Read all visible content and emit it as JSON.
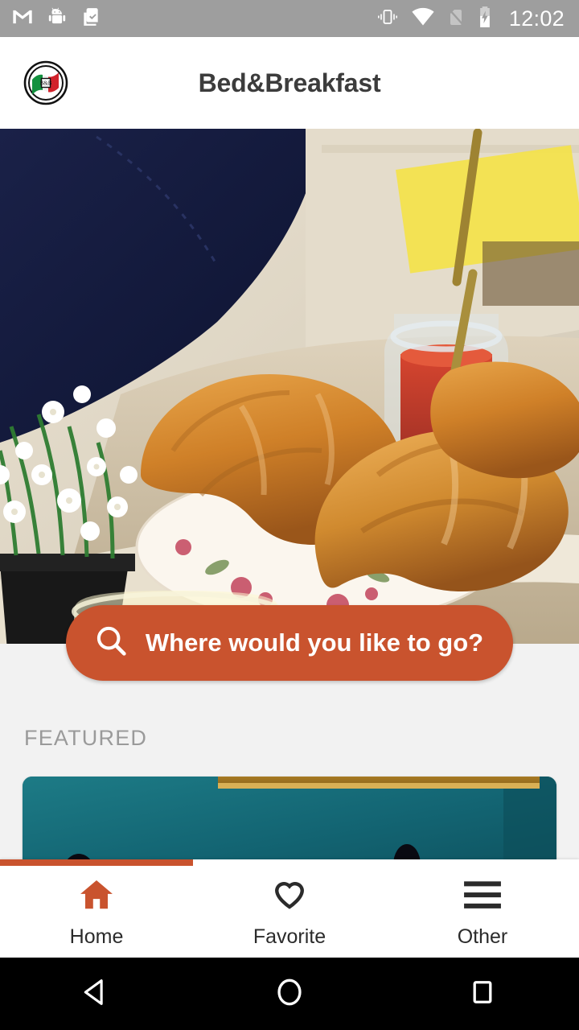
{
  "status_bar": {
    "time": "12:02",
    "left_icons": [
      "gmail-icon",
      "android-robot-icon",
      "clipboard-check-icon"
    ],
    "right_icons": [
      "vibrate-icon",
      "wifi-icon",
      "no-sim-icon",
      "battery-charging-icon"
    ],
    "background_color": "#9e9e9e"
  },
  "app_bar": {
    "title": "Bed&Breakfast",
    "logo_name": "italian-flag-roundel-logo",
    "background_color": "#ffffff",
    "title_color": "#3c3c3c"
  },
  "hero": {
    "alt": "Breakfast tray with croissants, orange juice, jam jar and white flowers",
    "name": "hero-breakfast-image"
  },
  "search": {
    "label": "Where would you like to go?",
    "line1": "Where would you like",
    "line2": "to go?",
    "icon": "search-icon",
    "accent_color": "#c9532e",
    "text_color": "#ffffff"
  },
  "featured": {
    "section_label": "FEATURED",
    "section_label_color": "#9a9a9a",
    "card": {
      "name": "featured-card",
      "alt": "Teal painted wall with gilded picture frame and lamps"
    }
  },
  "bottom_nav": {
    "active_index": 0,
    "indicator_color": "#c9532e",
    "items": [
      {
        "label": "Home",
        "icon": "home-icon",
        "active": true
      },
      {
        "label": "Favorite",
        "icon": "heart-icon",
        "active": false
      },
      {
        "label": "Other",
        "icon": "hamburger-menu-icon",
        "active": false
      }
    ]
  },
  "android_nav": {
    "items": [
      {
        "name": "back-button",
        "icon": "triangle-back-icon"
      },
      {
        "name": "home-button",
        "icon": "circle-home-icon"
      },
      {
        "name": "recents-button",
        "icon": "square-recents-icon"
      }
    ]
  }
}
